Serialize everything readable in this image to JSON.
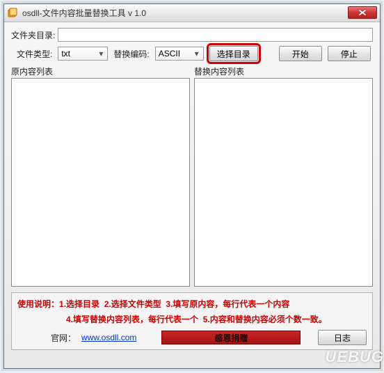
{
  "window": {
    "title": "osdll-文件内容批量替换工具 v 1.0"
  },
  "labels": {
    "folder": "文件夹目录:",
    "filetype": "文件类型:",
    "encoding": "替换编码:",
    "original_list": "原内容列表",
    "replace_list": "替换内容列表"
  },
  "inputs": {
    "folder_value": "",
    "filetype_value": "txt",
    "encoding_value": "ASCII"
  },
  "buttons": {
    "choose_dir": "选择目录",
    "start": "开始",
    "stop": "停止",
    "donate": "感恩捐赠",
    "log": "日志"
  },
  "instructions": {
    "prefix": "使用说明：",
    "step1": "1.选择目录",
    "step2": "2.选择文件类型",
    "step3": "3.填写原内容，每行代表一个内容",
    "step4": "4.填写替换内容列表，每行代表一个",
    "step5": "5.内容和替换内容必须个数一致。"
  },
  "site": {
    "label": "官网：",
    "url": "www.osdll.com"
  },
  "watermark": "UEBUG"
}
